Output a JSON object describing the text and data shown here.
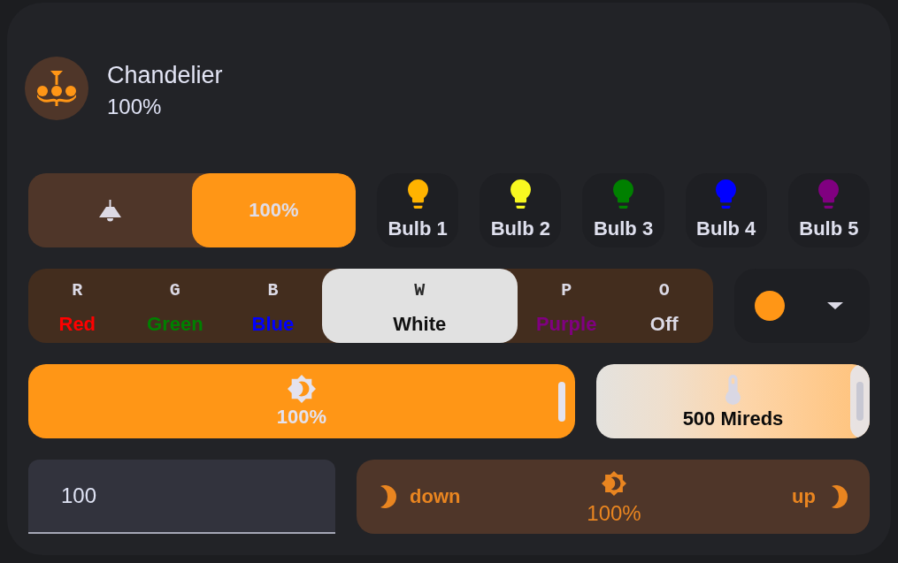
{
  "header": {
    "name": "Chandelier",
    "state": "100%"
  },
  "power_select": {
    "options": [
      {
        "kind": "icon",
        "selected": false
      },
      {
        "kind": "text",
        "label": "100%",
        "selected": true
      }
    ]
  },
  "bulbs": [
    {
      "label": "Bulb 1",
      "color": "#ffb300"
    },
    {
      "label": "Bulb 2",
      "color": "#f8f820"
    },
    {
      "label": "Bulb 3",
      "color": "#008000"
    },
    {
      "label": "Bulb 4",
      "color": "#0000ff"
    },
    {
      "label": "Bulb 5",
      "color": "#800080"
    }
  ],
  "color_modes": [
    {
      "letter": "R",
      "label": "Red",
      "color": "#ff0000",
      "selected": false
    },
    {
      "letter": "G",
      "label": "Green",
      "color": "#008000",
      "selected": false
    },
    {
      "letter": "B",
      "label": "Blue",
      "color": "#0000ff",
      "selected": false
    },
    {
      "letter": "W",
      "label": "White",
      "selected": true
    },
    {
      "letter": "P",
      "label": "Purple",
      "color": "#800080",
      "selected": false
    },
    {
      "letter": "O",
      "label": "Off",
      "selected": false
    }
  ],
  "color_picker": {
    "color": "#ff9616"
  },
  "brightness_slider": {
    "level": 1,
    "reading": "100%"
  },
  "temperature_slider": {
    "level": 1,
    "reading": "500 Mireds"
  },
  "brightness_input": {
    "value": "100"
  },
  "brightness_stepper": {
    "down_label": "down",
    "reading": "100%",
    "up_label": "up"
  }
}
